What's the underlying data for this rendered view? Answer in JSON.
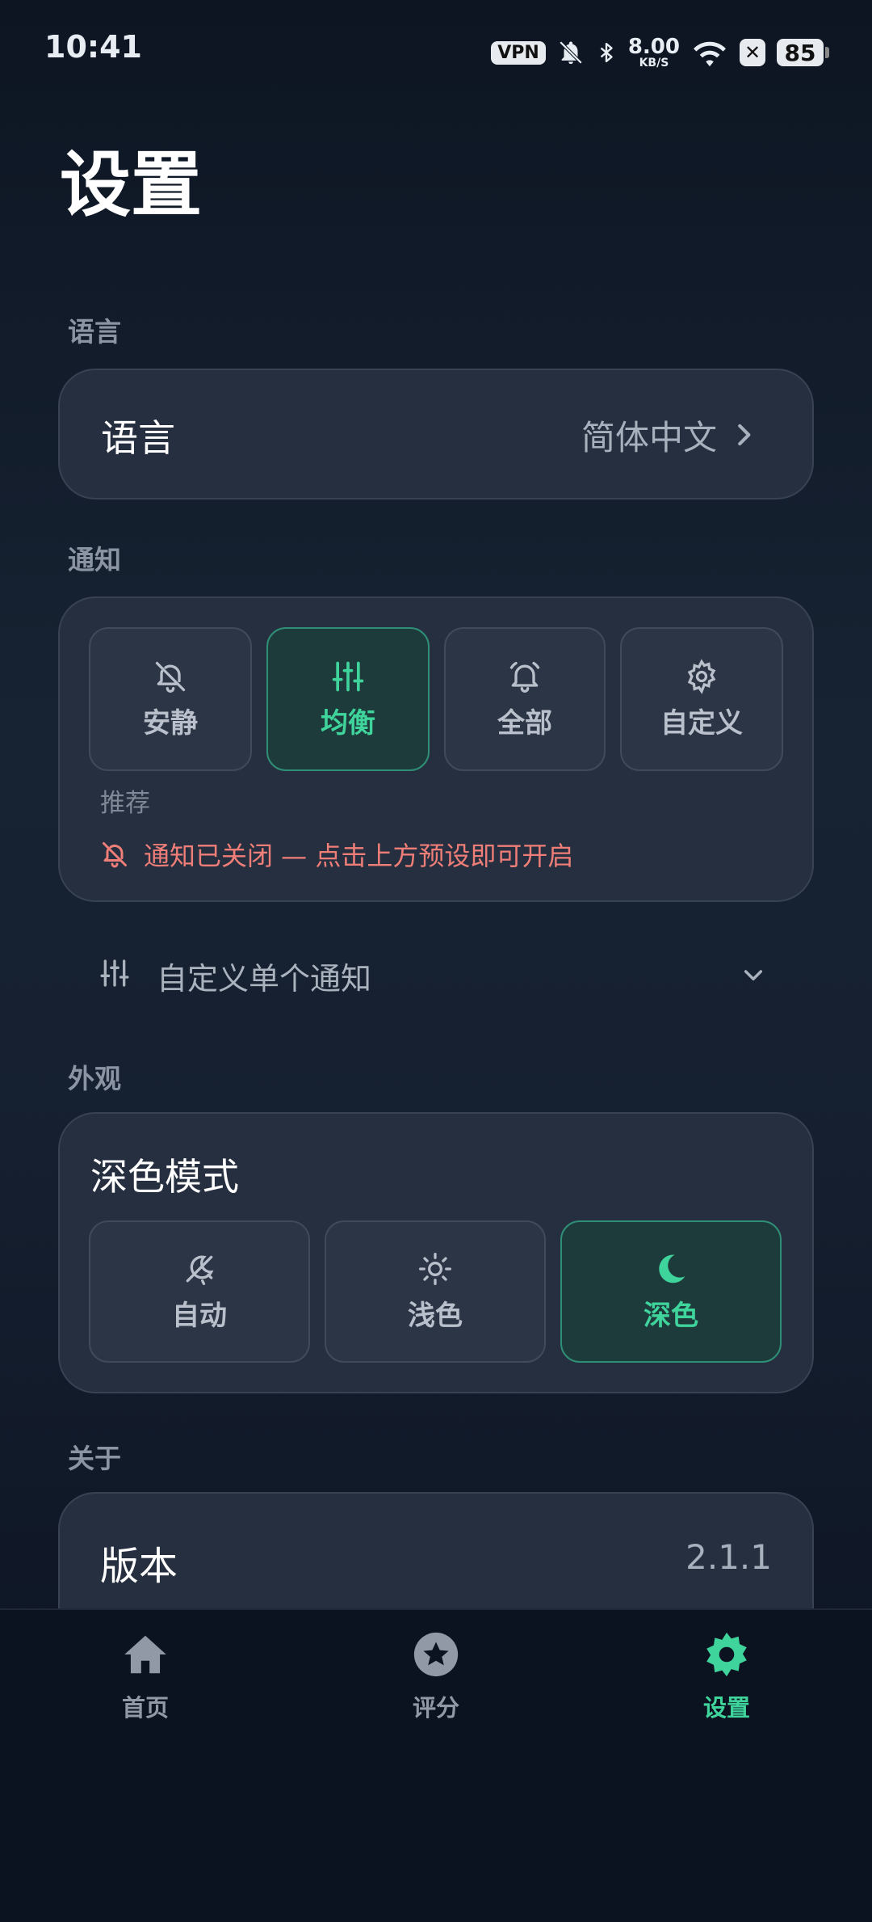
{
  "status_bar": {
    "time": "10:41",
    "vpn": "VPN",
    "speed_value": "8.00",
    "speed_unit": "KB/S",
    "battery": "85",
    "icons": [
      "mute-bell-icon",
      "bluetooth-icon",
      "wifi-icon",
      "x-box-icon",
      "battery-icon"
    ]
  },
  "page": {
    "title": "设置"
  },
  "language": {
    "section": "语言",
    "label": "语言",
    "value": "简体中文"
  },
  "notifications": {
    "section": "通知",
    "presets": [
      {
        "label": "安静",
        "icon": "bell-off-icon",
        "active": false
      },
      {
        "label": "均衡",
        "icon": "sliders-icon",
        "active": true
      },
      {
        "label": "全部",
        "icon": "bell-icon",
        "active": false
      },
      {
        "label": "自定义",
        "icon": "gear-icon",
        "active": false
      }
    ],
    "recommended_caption": "推荐",
    "warning": "通知已关闭 — 点击上方预设即可开启",
    "custom_row": "自定义单个通知"
  },
  "appearance": {
    "section": "外观",
    "dark_mode_title": "深色模式",
    "modes": [
      {
        "label": "自动",
        "icon": "auto-theme-icon",
        "active": false
      },
      {
        "label": "浅色",
        "icon": "sun-icon",
        "active": false
      },
      {
        "label": "深色",
        "icon": "moon-icon",
        "active": true
      }
    ]
  },
  "about": {
    "section": "关于",
    "version_label": "版本",
    "version_value": "2.1.1"
  },
  "bottom_nav": {
    "home": "首页",
    "rate": "评分",
    "settings": "设置",
    "active": "settings"
  },
  "colors": {
    "accent": "#3fd49c",
    "warning": "#f07e78",
    "card": "#262f3f",
    "background": "#141e2d"
  }
}
